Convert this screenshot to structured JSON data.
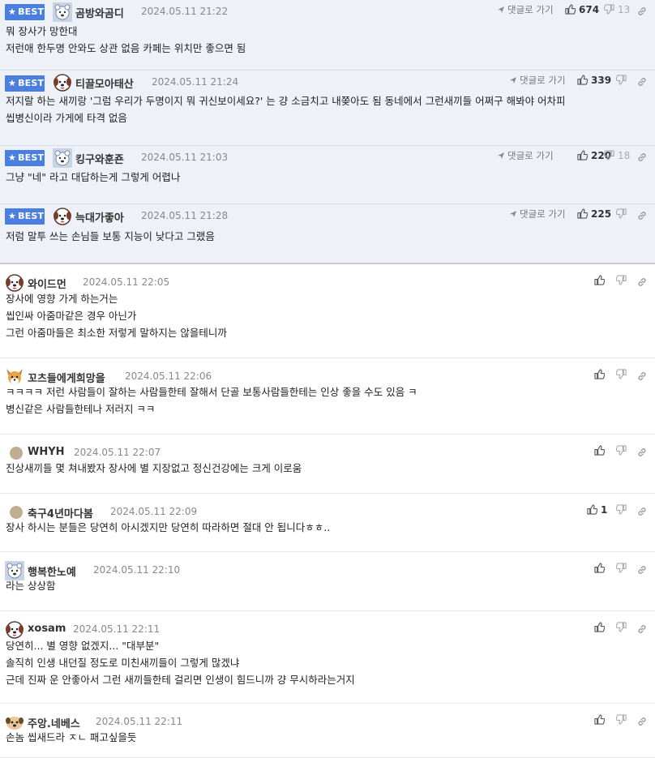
{
  "labels": {
    "best": "BEST",
    "reply": "댓글로 가기"
  },
  "colors": {
    "badge": "#4a7fe0",
    "best_bg": "#eef1f8"
  },
  "comments": [
    {
      "best": true,
      "nick": "곰방와곰디",
      "date": "2024.05.11 21:22",
      "up": "674",
      "down": "13",
      "avatar": "bear-avatar",
      "lines": [
        "뭐 장사가 망한대",
        "저런애 한두명 안와도 상관 없음 카페는 위치만 좋으면 됨"
      ]
    },
    {
      "best": true,
      "nick": "티끌모아태산",
      "date": "2024.05.11 21:24",
      "up": "339",
      "down": "",
      "avatar": "dog-avatar",
      "lines": [
        "저지랄 하는 새끼랑 '그럼 우리가 두명이지 뭐 귀신보이세요?' 는 걍 소금치고 내쫒아도 됨 동네에서 그런새끼들 어쩌구 해봐야 어차피",
        "씹병신이라 가게에 타격 없음"
      ]
    },
    {
      "best": true,
      "nick": "킹구와훈죤",
      "date": "2024.05.11 21:03",
      "up": "220",
      "down": "18",
      "avatar": "bear-avatar",
      "lines": [
        "그냥 \"네\" 라고 대답하는게 그렇게 어렵나"
      ]
    },
    {
      "best": true,
      "nick": "늑대가좋아",
      "date": "2024.05.11 21:28",
      "up": "225",
      "down": "",
      "avatar": "dog-avatar",
      "lines": [
        "저럼 말투 쓰는 손님들 보통 지능이 낮다고 그랬음"
      ]
    },
    {
      "best": false,
      "nick": "와이드먼",
      "date": "2024.05.11 22:05",
      "up": "",
      "avatar": "dog-avatar",
      "lines": [
        "장사에 영향 가게 하는거는",
        "씹인싸 아줌마같은 경우 아닌가",
        "그런 아줌마들은 최소한 저렇게 말하지는 않을테니까"
      ]
    },
    {
      "best": false,
      "nick": "꼬츠들에게희망을",
      "date": "2024.05.11 22:06",
      "up": "",
      "avatar": "fox-avatar",
      "lines": [
        "ㅋㅋㅋㅋ 저런 사람들이 잘하는 사람들한테 잘해서 단골 보통사람들한테는 인상 좋을 수도 있음 ㅋ",
        "병신같은 사람들한테나 저러지 ㅋㅋ"
      ]
    },
    {
      "best": false,
      "nick": "WHYH",
      "date": "2024.05.11 22:07",
      "up": "",
      "avatar": "dot-avatar",
      "lines": [
        "진상새끼들 몇 쳐내봤자 장사에 별 지장없고 정신건강에는 크게 이로움"
      ]
    },
    {
      "best": false,
      "nick": "축구4년마다봄",
      "date": "2024.05.11 22:09",
      "up": "1",
      "avatar": "dot-avatar",
      "lines": [
        "장사 하시는 분들은 당연히 아시겠지만 당연히 따라하면 절대 안 됩니다ㅎㅎ.."
      ]
    },
    {
      "best": false,
      "nick": "행복한노예",
      "date": "2024.05.11 22:10",
      "up": "",
      "avatar": "bear-avatar",
      "lines": [
        "라는 상상함"
      ]
    },
    {
      "best": false,
      "nick": "xosam",
      "date": "2024.05.11 22:11",
      "up": "",
      "avatar": "dog-avatar",
      "lines": [
        "당연히... 별 영향 없겠지... \"대부분\"",
        "솔직히 인생 내던질 정도로 미친새끼들이 그렇게 많겠냐",
        "근데 진짜 운 안좋아서 그런 새끼들한테 걸리면 인생이 힘드니까 걍 무시하라는거지"
      ]
    },
    {
      "best": false,
      "nick": "주앙.네베스",
      "date": "2024.05.11 22:11",
      "up": "",
      "avatar": "puppy-avatar",
      "lines": [
        "손놈 씹새드라 ㅈㄴ 패고싶을듯"
      ]
    }
  ]
}
